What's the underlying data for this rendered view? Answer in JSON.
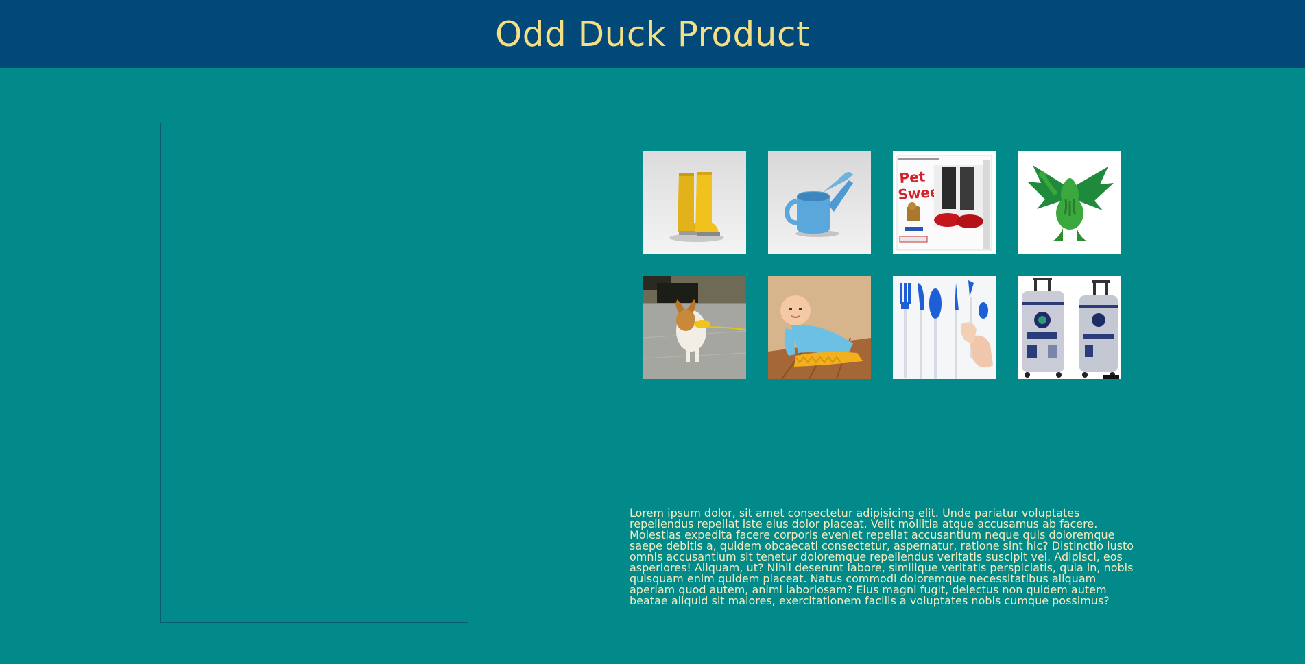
{
  "header": {
    "title": "Odd Duck Product"
  },
  "products": [
    {
      "name": "boots",
      "icon": "boots-image"
    },
    {
      "name": "water-can",
      "icon": "water-can-image"
    },
    {
      "name": "pet-sweep",
      "icon": "pet-sweep-image",
      "label": "Pet Sweep"
    },
    {
      "name": "cthulhu",
      "icon": "cthulhu-image"
    },
    {
      "name": "dog-duck",
      "icon": "dog-duck-image"
    },
    {
      "name": "sweep",
      "icon": "baby-sweep-image"
    },
    {
      "name": "usb-utensils",
      "icon": "utensils-image"
    },
    {
      "name": "r2d2-bag",
      "icon": "r2d2-luggage-image"
    }
  ],
  "description": "Lorem ipsum dolor, sit amet consectetur adipisicing elit. Unde pariatur voluptates repellendus repellat iste eius dolor placeat. Velit mollitia atque accusamus ab facere. Molestias expedita facere corporis eveniet repellat accusantium neque quis doloremque saepe debitis a, quidem obcaecati consectetur, aspernatur, ratione sint hic? Distinctio iusto omnis accusantium sit tenetur doloremque repellendus veritatis suscipit vel. Adipisci, eos asperiores! Aliquam, ut? Nihil deserunt labore, similique veritatis perspiciatis, quia in, nobis quisquam enim quidem placeat. Natus commodi doloremque necessitatibus aliquam aperiam quod autem, animi laboriosam? Eius magni fugit, delectus non quidem autem beatae aliquid sit maiores, exercitationem facilis a voluptates nobis cumque possimus?",
  "colors": {
    "header_bg": "#02497a",
    "page_bg": "#028a8a",
    "title": "#f4df86",
    "text": "#f4ecc0"
  }
}
